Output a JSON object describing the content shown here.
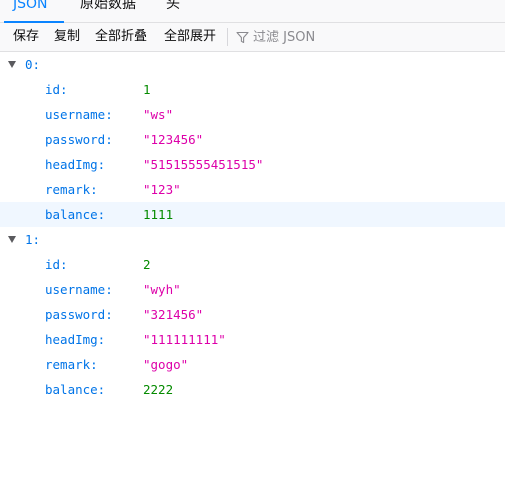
{
  "tabs": [
    {
      "label": "JSON"
    },
    {
      "label": "原始数据"
    },
    {
      "label": "头"
    }
  ],
  "toolbar": {
    "save": "保存",
    "copy": "复制",
    "collapse_all": "全部折叠",
    "expand_all": "全部展开",
    "filter_placeholder": "过滤 JSON"
  },
  "records": [
    {
      "index": "0:",
      "fields": [
        {
          "key": "id:",
          "value": "1",
          "type": "number"
        },
        {
          "key": "username:",
          "value": "\"ws\"",
          "type": "string"
        },
        {
          "key": "password:",
          "value": "\"123456\"",
          "type": "string"
        },
        {
          "key": "headImg:",
          "value": "\"51515555451515\"",
          "type": "string"
        },
        {
          "key": "remark:",
          "value": "\"123\"",
          "type": "string"
        },
        {
          "key": "balance:",
          "value": "1111",
          "type": "number"
        }
      ]
    },
    {
      "index": "1:",
      "fields": [
        {
          "key": "id:",
          "value": "2",
          "type": "number"
        },
        {
          "key": "username:",
          "value": "\"wyh\"",
          "type": "string"
        },
        {
          "key": "password:",
          "value": "\"321456\"",
          "type": "string"
        },
        {
          "key": "headImg:",
          "value": "\"111111111\"",
          "type": "string"
        },
        {
          "key": "remark:",
          "value": "\"gogo\"",
          "type": "string"
        },
        {
          "key": "balance:",
          "value": "2222",
          "type": "number"
        }
      ]
    }
  ],
  "colors": {
    "accent": "#0a84ff",
    "key": "#0074e8",
    "number": "#058b00",
    "string": "#dd00a9",
    "row_highlight": "#f0f7ff"
  }
}
